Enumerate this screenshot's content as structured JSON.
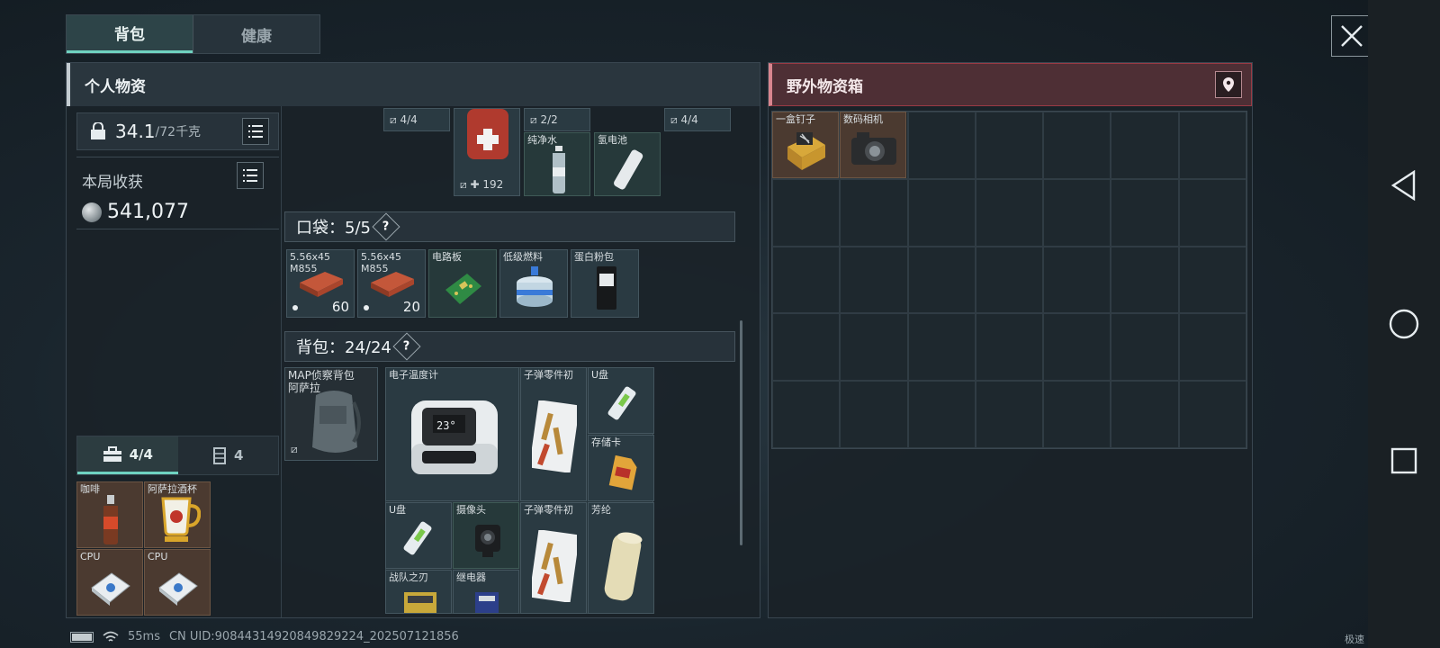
{
  "tabs": {
    "backpack": "背包",
    "health": "健康"
  },
  "left_panel": {
    "title": "个人物资",
    "weight_value": "34.1",
    "weight_max": "/72千克",
    "gain_label": "本局收获",
    "gain_value": "541,077",
    "sub_tab_case": "4/4",
    "sub_tab_safe": "4"
  },
  "top_items": {
    "slot_a_badge": "4/4",
    "medkit_count": "✚ 192",
    "slot_b_badge": "2/2",
    "slot_c_badge": "4/4",
    "water_label": "纯净水",
    "battery_label": "氢电池"
  },
  "pocket": {
    "label": "口袋：5/5",
    "help": "?",
    "items": [
      {
        "name": "5.56x45\nM855",
        "count": "60"
      },
      {
        "name": "5.56x45\nM855",
        "count": "20"
      },
      {
        "name": "电路板",
        "count": ""
      },
      {
        "name": "低级燃料",
        "count": ""
      },
      {
        "name": "蛋白粉包",
        "count": ""
      }
    ]
  },
  "backpack": {
    "label": "背包：24/24",
    "help": "?",
    "bag_name": "MAP侦察背包\n阿萨拉",
    "items": {
      "thermometer": "电子温度计",
      "thermo_display": "23°",
      "ammo_parts_1": "子弹零件初",
      "usb_1": "U盘",
      "memory_card": "存储卡",
      "usb_2": "U盘",
      "camera": "摄像头",
      "ammo_parts_2": "子弹零件初",
      "aromatic": "芳纶",
      "team_blade": "战队之刃",
      "relay": "继电器"
    }
  },
  "safe_box": {
    "items": [
      {
        "name": "咖啡"
      },
      {
        "name": "阿萨拉酒杯"
      },
      {
        "name": "CPU"
      },
      {
        "name": "CPU"
      }
    ]
  },
  "right_panel": {
    "title": "野外物资箱",
    "items": [
      {
        "name": "一盒钉子"
      },
      {
        "name": "数码相机"
      }
    ]
  },
  "status": {
    "ping": "55ms",
    "uid": "CN UID:9084431492084982922​4_202507121856",
    "speed_tag": "极速"
  },
  "colors": {
    "accent": "#6fd2c0",
    "red_header": "#4e2f35",
    "slot_brown": "#4b3a30"
  }
}
